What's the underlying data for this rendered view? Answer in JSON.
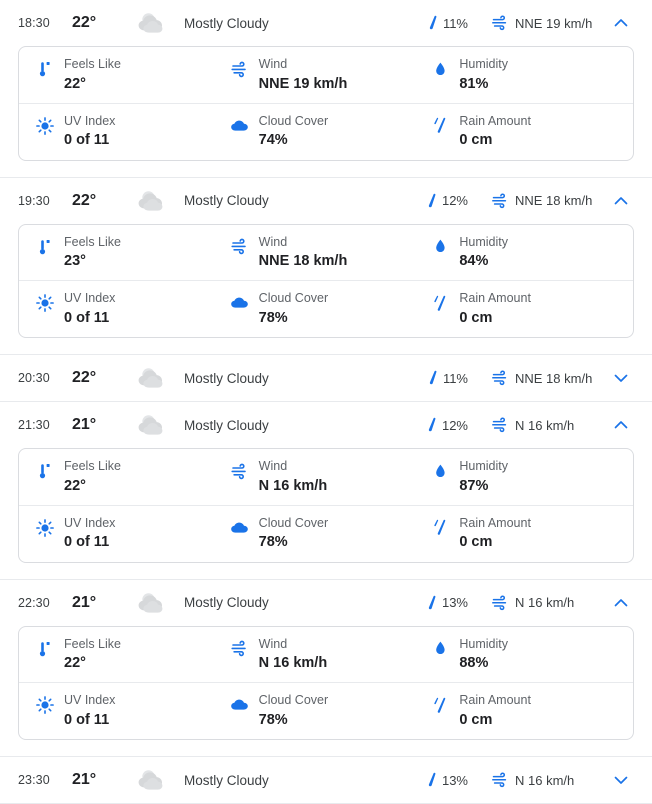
{
  "labels": {
    "feels_like": "Feels Like",
    "wind": "Wind",
    "humidity": "Humidity",
    "uv_index": "UV Index",
    "cloud_cover": "Cloud Cover",
    "rain_amount": "Rain Amount"
  },
  "icons": {
    "weather": "mostly-cloudy-icon",
    "precip": "precipitation-drop-icon",
    "wind": "wind-icon",
    "expand": "chevron-up-icon",
    "collapse": "chevron-down-icon",
    "feels_like": "thermometer-icon",
    "humidity": "humidity-drop-icon",
    "uv_index": "sun-uv-icon",
    "cloud_cover": "cloud-icon",
    "rain_amount": "rain-drops-icon"
  },
  "colors": {
    "accent_blue": "#1a73e8",
    "text_primary": "#202124",
    "text_secondary": "#5f6368",
    "border": "#dadce0",
    "divider": "#e8eaed",
    "weather_icon_gray": "#d6d8da"
  },
  "hours": [
    {
      "time": "18:30",
      "temp": "22°",
      "condition": "Mostly Cloudy",
      "precip": "11%",
      "wind": "NNE 19 km/h",
      "expanded": true,
      "details": {
        "feels_like": "22°",
        "wind": "NNE 19 km/h",
        "humidity": "81%",
        "uv_index": "0 of 11",
        "cloud_cover": "74%",
        "rain_amount": "0 cm"
      }
    },
    {
      "time": "19:30",
      "temp": "22°",
      "condition": "Mostly Cloudy",
      "precip": "12%",
      "wind": "NNE 18 km/h",
      "expanded": true,
      "details": {
        "feels_like": "23°",
        "wind": "NNE 18 km/h",
        "humidity": "84%",
        "uv_index": "0 of 11",
        "cloud_cover": "78%",
        "rain_amount": "0 cm"
      }
    },
    {
      "time": "20:30",
      "temp": "22°",
      "condition": "Mostly Cloudy",
      "precip": "11%",
      "wind": "NNE 18 km/h",
      "expanded": false,
      "details": null
    },
    {
      "time": "21:30",
      "temp": "21°",
      "condition": "Mostly Cloudy",
      "precip": "12%",
      "wind": "N 16 km/h",
      "expanded": true,
      "details": {
        "feels_like": "22°",
        "wind": "N 16 km/h",
        "humidity": "87%",
        "uv_index": "0 of 11",
        "cloud_cover": "78%",
        "rain_amount": "0 cm"
      }
    },
    {
      "time": "22:30",
      "temp": "21°",
      "condition": "Mostly Cloudy",
      "precip": "13%",
      "wind": "N 16 km/h",
      "expanded": true,
      "details": {
        "feels_like": "22°",
        "wind": "N 16 km/h",
        "humidity": "88%",
        "uv_index": "0 of 11",
        "cloud_cover": "78%",
        "rain_amount": "0 cm"
      }
    },
    {
      "time": "23:30",
      "temp": "21°",
      "condition": "Mostly Cloudy",
      "precip": "13%",
      "wind": "N 16 km/h",
      "expanded": false,
      "details": null
    }
  ]
}
